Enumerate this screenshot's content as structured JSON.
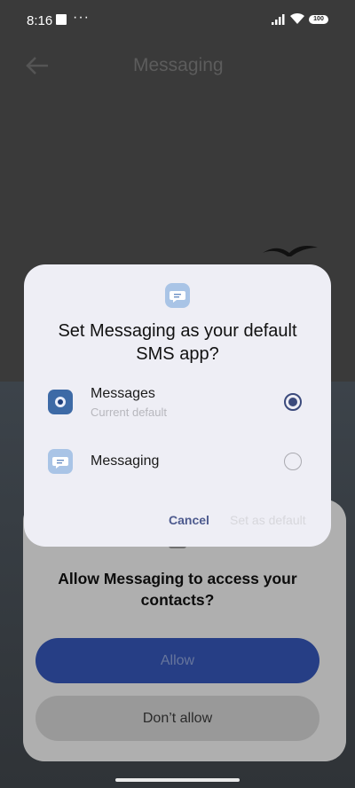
{
  "status_bar": {
    "time": "8:16",
    "more": "···",
    "battery": "100"
  },
  "background_app": {
    "title": "Messaging",
    "back_icon": "arrow-left-icon"
  },
  "dialog": {
    "title": "Set Messaging as your default SMS app?",
    "app_icon": "chat-bubble-icon",
    "options": [
      {
        "label": "Messages",
        "sublabel": "Current default",
        "selected": true,
        "icon_color": "#3d6aa6"
      },
      {
        "label": "Messaging",
        "sublabel": "",
        "selected": false,
        "icon_color": "#a9c4e6"
      }
    ],
    "cancel_label": "Cancel",
    "set_default_label": "Set as default",
    "accent_color": "#4d5a8e"
  },
  "permission_sheet": {
    "title": "Allow Messaging to access your contacts?",
    "allow_label": "Allow",
    "deny_label": "Don’t allow",
    "allow_color": "#3557b9"
  }
}
